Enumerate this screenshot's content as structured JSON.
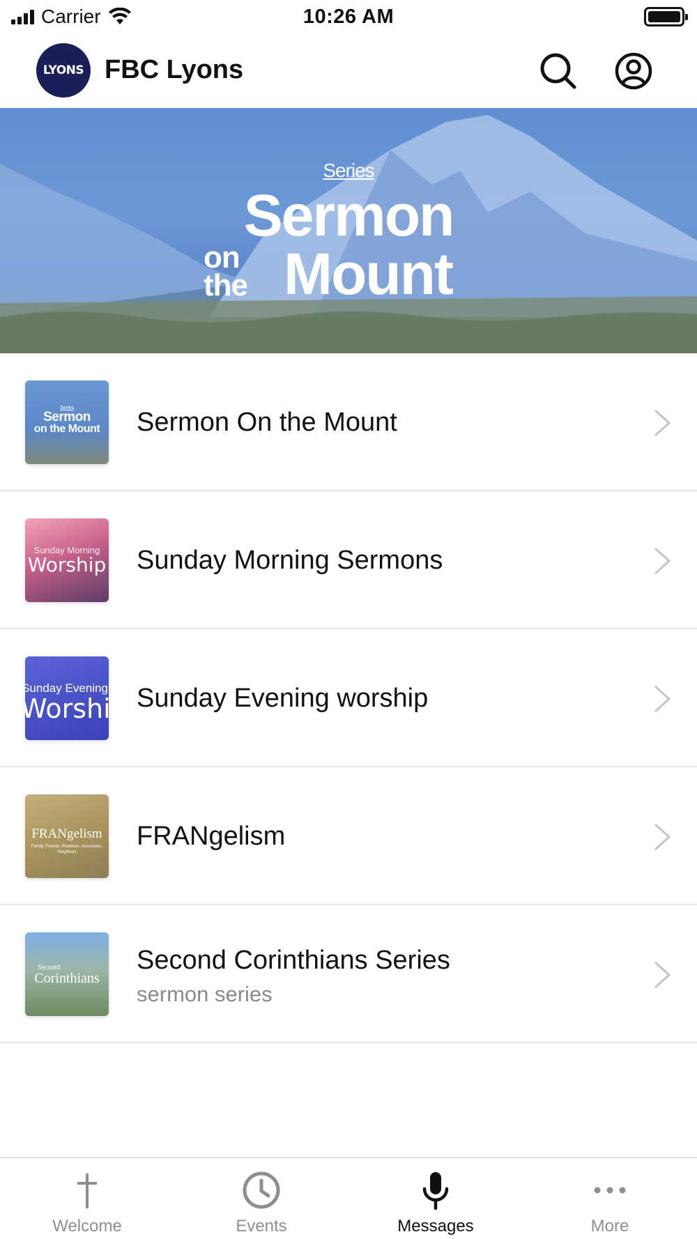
{
  "status_bar": {
    "carrier": "Carrier",
    "time": "10:26 AM"
  },
  "header": {
    "logo_text": "LYONS",
    "title": "FBC Lyons",
    "icons": [
      "search-icon",
      "profile-icon"
    ]
  },
  "hero": {
    "kicker": "Series",
    "title_line1": "Sermon",
    "title_on": "on",
    "title_the": "the",
    "title_mount": "Mount"
  },
  "series": [
    {
      "title": "Sermon On the Mount",
      "subtitle": "",
      "thumb_kicker": "Series",
      "thumb_line1": "Sermon",
      "thumb_line2": "on the Mount"
    },
    {
      "title": "Sunday Morning Sermons",
      "subtitle": "",
      "thumb_line1": "Sunday Morning",
      "thumb_line2": "Worship"
    },
    {
      "title": "Sunday Evening worship",
      "subtitle": "",
      "thumb_line1": "Sunday Evening",
      "thumb_line2": "Worship"
    },
    {
      "title": "FRANgelism",
      "subtitle": "",
      "thumb_line1": "FRANgelism",
      "thumb_line2": "Family, Friends, Relatives, Associates, Neighbors"
    },
    {
      "title": "Second Corinthians Series",
      "subtitle": "sermon series",
      "thumb_line1": "Second",
      "thumb_line2": "Corinthians"
    }
  ],
  "tabs": [
    {
      "label": "Welcome",
      "icon": "cross-icon",
      "active": false
    },
    {
      "label": "Events",
      "icon": "clock-icon",
      "active": false
    },
    {
      "label": "Messages",
      "icon": "microphone-icon",
      "active": true
    },
    {
      "label": "More",
      "icon": "ellipsis-icon",
      "active": false
    }
  ],
  "colors": {
    "tab_active": "#111111",
    "tab_inactive": "#8e8e8e",
    "logo_bg": "#1a1f5a",
    "hero_blue": "#6592d3"
  }
}
